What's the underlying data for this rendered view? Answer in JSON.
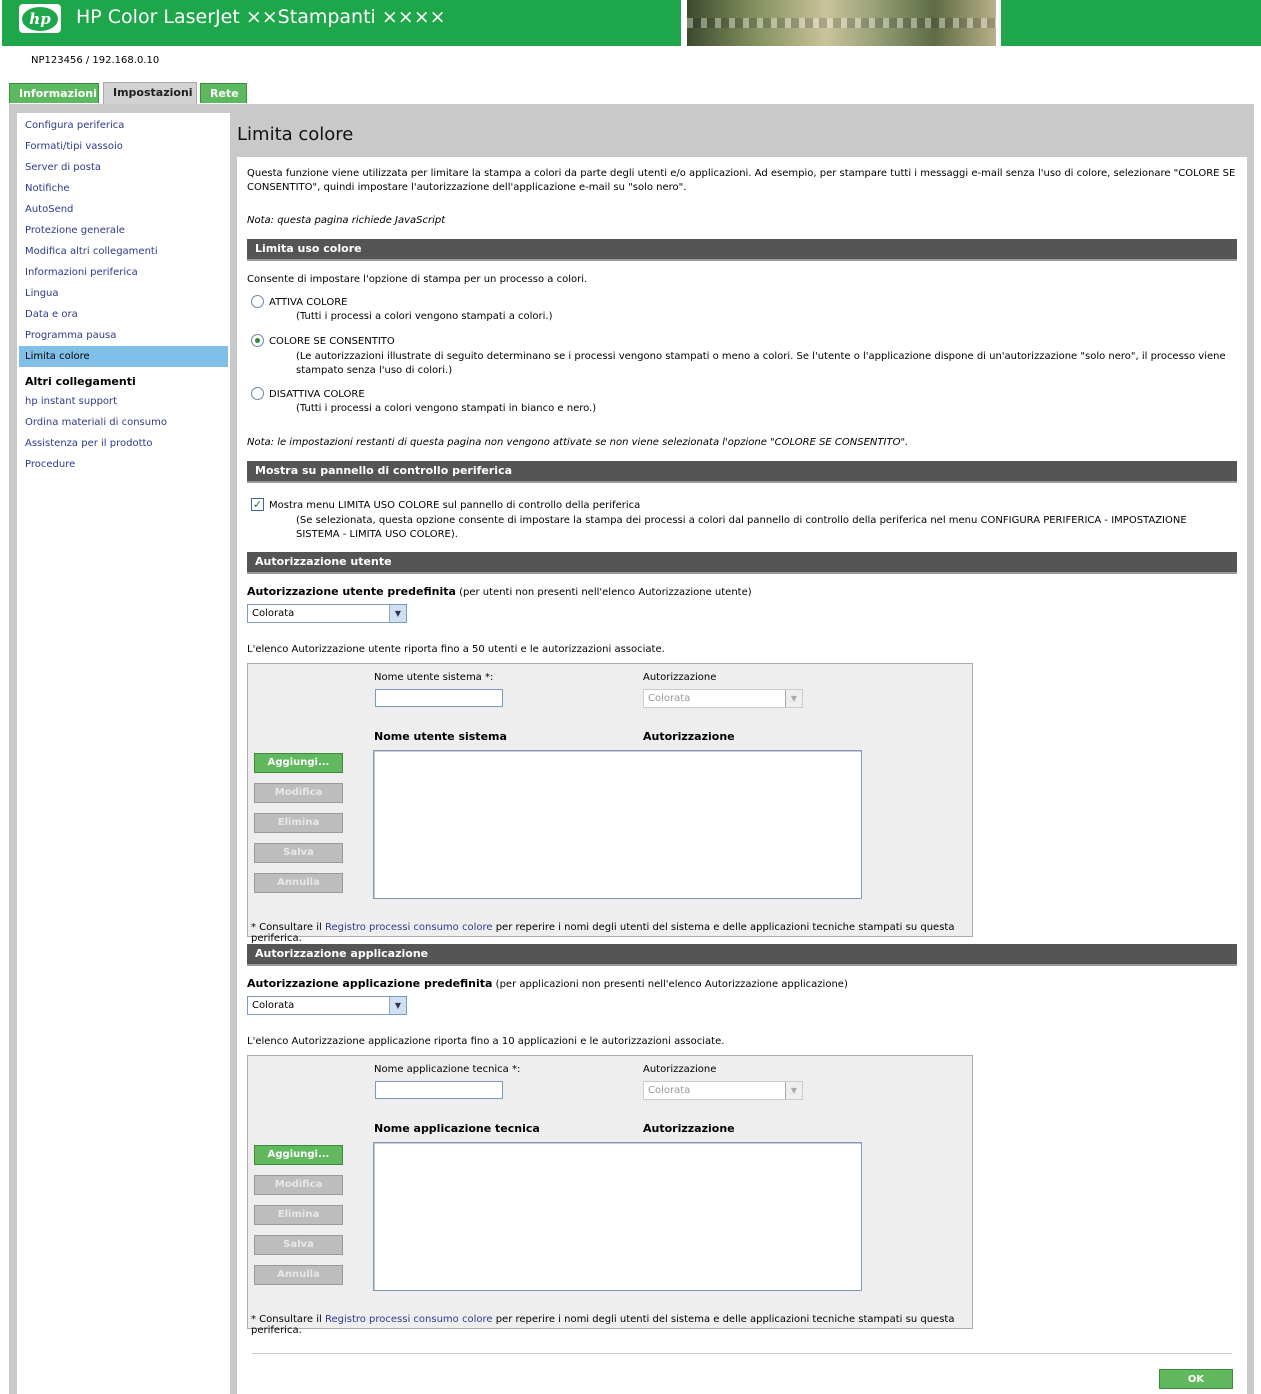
{
  "header": {
    "title": "HP Color LaserJet ××Stampanti ××××",
    "logo": "hp"
  },
  "device": "NP123456 / 192.168.0.10",
  "tabs": [
    "Informazioni",
    "Impostazioni",
    "Rete"
  ],
  "sidebar": {
    "items": [
      "Configura periferica",
      "Formati/tipi vassoio",
      "Server di posta",
      "Notifiche",
      "AutoSend",
      "Protezione generale",
      "Modifica altri collegamenti",
      "Informazioni periferica",
      "Lingua",
      "Data e ora",
      "Programma pausa",
      "Limita colore"
    ],
    "other_header": "Altri collegamenti",
    "other": [
      "hp instant support",
      "Ordina materiali di consumo",
      "Assistenza per il prodotto",
      "Procedure"
    ]
  },
  "page": {
    "title": "Limita colore",
    "intro": "Questa funzione viene utilizzata per limitare la stampa a colori da parte degli utenti e/o applicazioni. Ad esempio, per stampare tutti i messaggi e-mail senza l'uso di colore, selezionare \"COLORE SE CONSENTITO\", quindi impostare l'autorizzazione dell'applicazione e-mail su \"solo nero\".",
    "js_note": "Nota: questa pagina richiede JavaScript"
  },
  "limit": {
    "header": "Limita uso colore",
    "desc": "Consente di impostare l'opzione di stampa per un processo a colori.",
    "opt1": "ATTIVA COLORE",
    "opt1_desc": "(Tutti i processi a colori vengono stampati a colori.)",
    "opt2": "COLORE SE CONSENTITO",
    "opt2_desc": "(Le autorizzazioni illustrate di seguito determinano se i processi vengono stampati o meno a colori. Se l'utente o l'applicazione dispone di un'autorizzazione \"solo nero\", il processo viene stampato senza l'uso di colori.)",
    "opt3": "DISATTIVA COLORE",
    "opt3_desc": "(Tutti i processi a colori vengono stampati in bianco e nero.)",
    "selected": "COLORE SE CONSENTITO",
    "note": "Nota: le impostazioni restanti di questa pagina non vengono attivate se non viene selezionata l'opzione \"COLORE SE CONSENTITO\"."
  },
  "panel": {
    "header": "Mostra su pannello di controllo periferica",
    "label": "Mostra menu LIMITA USO COLORE sul pannello di controllo della periferica",
    "desc": "(Se selezionata, questa opzione consente di impostare la stampa dei processi a colori dal pannello di controllo della periferica nel menu CONFIGURA PERIFERICA - IMPOSTAZIONE SISTEMA - LIMITA USO COLORE).",
    "checked": true
  },
  "user": {
    "header": "Autorizzazione utente",
    "default_label": "Autorizzazione utente predefinita",
    "default_hint": " (per utenti non presenti nell'elenco Autorizzazione utente)",
    "default_value": "Colorata",
    "list_desc": "L'elenco Autorizzazione utente riporta fino a 50 utenti e le autorizzazioni associate.",
    "name_label": "Nome utente sistema *:",
    "auth_label": "Autorizzazione",
    "auth_value": "Colorata",
    "col1": "Nome utente sistema",
    "col2": "Autorizzazione",
    "name_value": ""
  },
  "app": {
    "header": "Autorizzazione applicazione",
    "default_label": "Autorizzazione applicazione predefinita",
    "default_hint": " (per applicazioni non presenti nell'elenco Autorizzazione applicazione)",
    "default_value": "Colorata",
    "list_desc": "L'elenco Autorizzazione applicazione riporta fino a 10 applicazioni e le autorizzazioni associate.",
    "name_label": "Nome applicazione tecnica *:",
    "auth_label": "Autorizzazione",
    "auth_value": "Colorata",
    "col1": "Nome applicazione tecnica",
    "col2": "Autorizzazione",
    "name_value": ""
  },
  "buttons": {
    "add": "Aggiungi...",
    "edit": "Modifica",
    "delete": "Elimina",
    "save": "Salva",
    "cancel": "Annulla",
    "ok": "OK"
  },
  "footnote": {
    "pre": "* Consultare il ",
    "link": "Registro processi consumo colore",
    "post": " per reperire i nomi degli utenti del sistema e delle applicazioni tecniche stampati su questa periferica."
  },
  "colors": {
    "brand": "#1ea74a",
    "section": "#555555",
    "link": "#2a3a8c",
    "active": "#7fbfe8"
  }
}
